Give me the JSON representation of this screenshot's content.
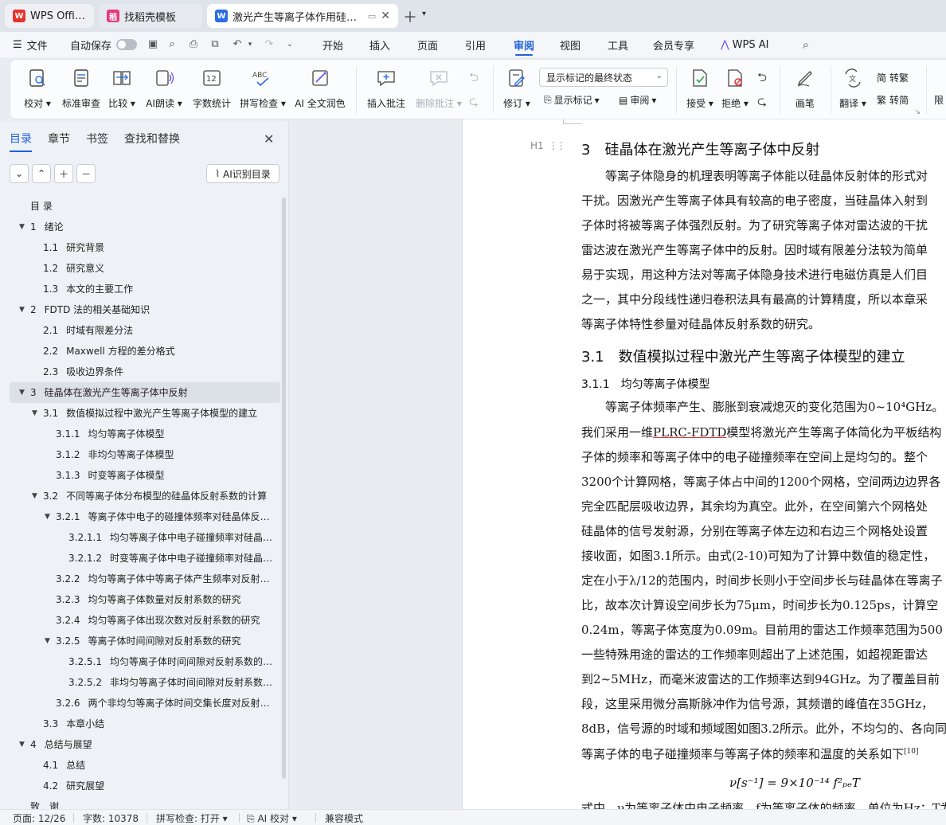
{
  "tabs": [
    {
      "label": "WPS Office",
      "icon": "wps-icon"
    },
    {
      "label": "找稻壳模板",
      "icon": "template-icon"
    },
    {
      "label": "激光产生等离子体作用硅晶体",
      "icon": "doc-icon"
    }
  ],
  "menubar": {
    "file": "文件",
    "autosave": "自动保存",
    "tabs": [
      "开始",
      "插入",
      "页面",
      "引用",
      "审阅",
      "视图",
      "工具",
      "会员专享",
      "WPS AI"
    ],
    "active_tab": "审阅"
  },
  "ribbon": {
    "proofread": "校对",
    "standard_review": "标准审查",
    "compare": "比较",
    "ai_read": "AI朗读",
    "word_count": "字数统计",
    "spell_check": "拼写检查",
    "ai_polish": "AI 全文润色",
    "insert_comment": "插入批注",
    "delete_comment": "删除批注",
    "revise": "修订",
    "markup_select": "显示标记的最终状态",
    "show_markup": "显示标记",
    "review": "审阅",
    "accept": "接受",
    "reject": "拒绝",
    "pen": "画笔",
    "translate": "翻译",
    "to_traditional": "转繁",
    "to_simplified": "转简",
    "limit": "限"
  },
  "nav": {
    "tabs": [
      "目录",
      "章节",
      "书签",
      "查找和替换"
    ],
    "active_tab": "目录",
    "ai_toc": "AI识别目录",
    "items": [
      {
        "num": "",
        "text": "目 录",
        "level": 0,
        "arrow": false
      },
      {
        "num": "1",
        "text": "绪论",
        "level": 0,
        "arrow": true
      },
      {
        "num": "1.1",
        "text": "研究背景",
        "level": 1,
        "arrow": false
      },
      {
        "num": "1.2",
        "text": "研究意义",
        "level": 1,
        "arrow": false
      },
      {
        "num": "1.3",
        "text": "本文的主要工作",
        "level": 1,
        "arrow": false
      },
      {
        "num": "2",
        "text": "FDTD 法的相关基础知识",
        "level": 0,
        "arrow": true
      },
      {
        "num": "2.1",
        "text": "时域有限差分法",
        "level": 1,
        "arrow": false
      },
      {
        "num": "2.2",
        "text": "Maxwell 方程的差分格式",
        "level": 1,
        "arrow": false
      },
      {
        "num": "2.3",
        "text": "吸收边界条件",
        "level": 1,
        "arrow": false
      },
      {
        "num": "3",
        "text": "硅晶体在激光产生等离子体中反射",
        "level": 0,
        "arrow": true,
        "selected": true
      },
      {
        "num": "3.1",
        "text": "数值模拟过程中激光产生等离子体模型的建立",
        "level": 1,
        "arrow": true
      },
      {
        "num": "3.1.1",
        "text": "均匀等离子体模型",
        "level": 2,
        "arrow": false
      },
      {
        "num": "3.1.2",
        "text": "非均匀等离子体模型",
        "level": 2,
        "arrow": false
      },
      {
        "num": "3.1.3",
        "text": "时变等离子体模型",
        "level": 2,
        "arrow": false
      },
      {
        "num": "3.2",
        "text": "不同等离子体分布模型的硅晶体反射系数的计算",
        "level": 1,
        "arrow": true
      },
      {
        "num": "3.2.1",
        "text": "等离子体中电子的碰撞体频率对硅晶体反射系数的影响",
        "level": 2,
        "arrow": true
      },
      {
        "num": "3.2.1.1",
        "text": "均匀等离子体中电子碰撞频率对硅晶体反射系数的影响",
        "level": 3,
        "arrow": false
      },
      {
        "num": "3.2.1.2",
        "text": "时变等离子体中电子碰撞频率对硅晶体反射系数的影响",
        "level": 3,
        "arrow": false
      },
      {
        "num": "3.2.2",
        "text": "均匀等离子体中等离子体产生频率对反射系数的影响",
        "level": 2,
        "arrow": false
      },
      {
        "num": "3.2.3",
        "text": "均匀等离子体数量对反射系数的研究",
        "level": 2,
        "arrow": false
      },
      {
        "num": "3.2.4",
        "text": "均匀等离子体出现次数对反射系数的研究",
        "level": 2,
        "arrow": false
      },
      {
        "num": "3.2.5",
        "text": "等离子体时间间隙对反射系数的研究",
        "level": 2,
        "arrow": true
      },
      {
        "num": "3.2.5.1",
        "text": "均匀等离子体时间间隙对反射系数的研究",
        "level": 3,
        "arrow": false
      },
      {
        "num": "3.2.5.2",
        "text": "非均匀等离子体时间间隙对反射系数的研究",
        "level": 3,
        "arrow": false
      },
      {
        "num": "3.2.6",
        "text": "两个非均匀等离子体时间交集长度对反射系数的研究",
        "level": 2,
        "arrow": false
      },
      {
        "num": "3.3",
        "text": "本章小结",
        "level": 1,
        "arrow": false
      },
      {
        "num": "4",
        "text": "总结与展望",
        "level": 0,
        "arrow": true
      },
      {
        "num": "4.1",
        "text": "总结",
        "level": 1,
        "arrow": false
      },
      {
        "num": "4.2",
        "text": "研究展望",
        "level": 1,
        "arrow": false
      },
      {
        "num": "",
        "text": "致　谢",
        "level": 0,
        "arrow": false
      }
    ]
  },
  "document": {
    "h1": "3　硅晶体在激光产生等离子体中反射",
    "heading_marker": "H1",
    "para1": [
      "　　等离子体隐身的机理表明等离子体能以硅晶体反射体的形式对",
      "干扰。因激光产生等离子体具有较高的电子密度，当硅晶体入射到",
      "子体时将被等离子体强烈反射。为了研究等离子体对雷达波的干扰",
      "雷达波在激光产生等离子体中的反射。因时域有限差分法较为简单",
      "易于实现，用这种方法对等离子体隐身技术进行电磁仿真是人们目",
      "之一，其中分段线性递归卷积法具有最高的计算精度，所以本章采",
      "等离子体特性参量对硅晶体反射系数的研究。"
    ],
    "h2": "3.1　数值模拟过程中激光产生等离子体模型的建立",
    "h3": "3.1.1　均匀等离子体模型",
    "para2_first": "　　等离子体频率产生、膨胀到衰减熄灭的变化范围为0~10⁴GHz。",
    "para2_pre": "我们采用一维",
    "para2_link": "PLRC-FDTD",
    "para2_post": "模型将激光产生等离子体简化为平板结构",
    "para2": [
      "子体的频率和等离子体中的电子碰撞频率在空间上是均匀的。整个",
      "3200个计算网格，等离子体占中间的1200个网格，空间两边边界各",
      "完全匹配层吸收边界，其余均为真空。此外，在空间第六个网格处",
      "硅晶体的信号发射源，分别在等离子体左边和右边三个网格处设置",
      "接收面，如图3.1所示。由式(2-10)可知为了计算中数值的稳定性，",
      "定在小于λ/12的范围内，时间步长则小于空间步长与硅晶体在等离子",
      "比，故本次计算设空间步长为75μm，时间步长为0.125ps，计算空",
      "0.24m，等离子体宽度为0.09m。目前用的雷达工作频率范围为500",
      "一些特殊用途的雷达的工作频率则超出了上述范围，如超视距雷达",
      "到2~5MHz，而毫米波雷达的工作频率达到94GHz。为了覆盖目前",
      "段，这里采用微分高斯脉冲作为信号源，其频谱的峰值在35GHz，",
      "8dB，信号源的时域和频域图如图3.2所示。此外，不均匀的、各向同"
    ],
    "para2_last": "等离子体的电子碰撞频率与等离子体的频率和温度的关系如下",
    "citation": "[10]",
    "formula": "ν[s⁻¹] = 9×10⁻¹⁴ f²ₚₑT",
    "cut_line": "式中，ν为等离子体中电子频率，f为等离子体的频率，单位为Hz；T为"
  },
  "status": {
    "page": "页面: 12/26",
    "words": "字数: 10378",
    "spell": "拼写检查: 打开",
    "ai_proof": "AI 校对",
    "compat": "兼容模式"
  }
}
